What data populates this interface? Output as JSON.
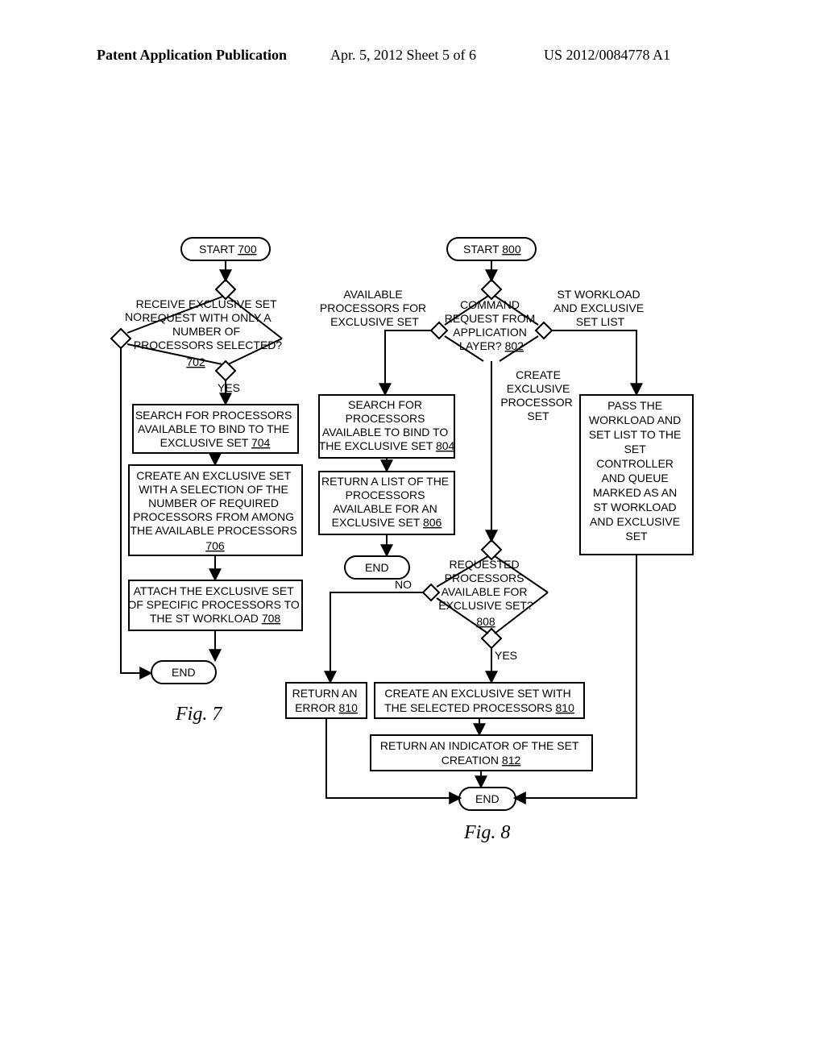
{
  "header": {
    "left": "Patent Application Publication",
    "mid": "Apr. 5, 2012  Sheet 5 of 6",
    "right": "US 2012/0084778 A1"
  },
  "fig7": {
    "start": "START",
    "start_ref": "700",
    "d702_l1": "RECEIVE EXCLUSIVE SET",
    "d702_l2": "REQUEST WITH ONLY A",
    "d702_l3": "NUMBER OF",
    "d702_l4": "PROCESSORS SELECTED?",
    "d702_ref": "702",
    "no": "NO",
    "yes": "YES",
    "b704_l1": "SEARCH FOR PROCESSORS",
    "b704_l2": "AVAILABLE TO BIND TO THE",
    "b704_l3": "EXCLUSIVE SET",
    "b704_ref": "704",
    "b706_l1": "CREATE AN EXCLUSIVE SET",
    "b706_l2": "WITH A SELECTION OF THE",
    "b706_l3": "NUMBER OF REQUIRED",
    "b706_l4": "PROCESSORS FROM AMONG",
    "b706_l5": "THE AVAILABLE PROCESSORS",
    "b706_ref": "706",
    "b708_l1": "ATTACH THE EXCLUSIVE SET",
    "b708_l2": "OF SPECIFIC PROCESSORS TO",
    "b708_l3": "THE ST WORKLOAD",
    "b708_ref": "708",
    "end": "END",
    "label": "Fig. 7"
  },
  "fig8": {
    "start": "START",
    "start_ref": "800",
    "d802_l1": "COMMAND",
    "d802_l2": "REQUEST FROM",
    "d802_l3": "APPLICATION",
    "d802_l4": "LAYER?",
    "d802_ref": "802",
    "branch_left_l1": "AVAILABLE",
    "branch_left_l2": "PROCESSORS FOR",
    "branch_left_l3": "EXCLUSIVE SET",
    "branch_mid_l1": "CREATE",
    "branch_mid_l2": "EXCLUSIVE",
    "branch_mid_l3": "PROCESSOR",
    "branch_mid_l4": "SET",
    "branch_right_l1": "ST WORKLOAD",
    "branch_right_l2": "AND EXCLUSIVE",
    "branch_right_l3": "SET LIST",
    "b804_l1": "SEARCH FOR",
    "b804_l2": "PROCESSORS",
    "b804_l3": "AVAILABLE TO BIND TO",
    "b804_l4": "THE EXCLUSIVE SET",
    "b804_ref": "804",
    "b806_l1": "RETURN A LIST OF THE",
    "b806_l2": "PROCESSORS",
    "b806_l3": "AVAILABLE FOR AN",
    "b806_l4": "EXCLUSIVE SET",
    "b806_ref": "806",
    "end_mid": "END",
    "d808_l1": "REQUESTED",
    "d808_l2": "PROCESSORS",
    "d808_l3": "AVAILABLE FOR",
    "d808_l4": "EXCLUSIVE SET?",
    "d808_ref": "808",
    "no": "NO",
    "yes": "YES",
    "bPass_l1": "PASS THE",
    "bPass_l2": "WORKLOAD AND",
    "bPass_l3": "SET LIST TO THE",
    "bPass_l4": "SET",
    "bPass_l5": "CONTROLLER",
    "bPass_l6": "AND QUEUE",
    "bPass_l7": "MARKED AS AN",
    "bPass_l8": "ST WORKLOAD",
    "bPass_l9": "AND EXCLUSIVE",
    "bPass_l10": "SET",
    "b810err_l1": "RETURN AN",
    "b810err_l2": "ERROR",
    "b810err_ref": "810",
    "b810_l1": "CREATE AN EXCLUSIVE SET WITH",
    "b810_l2": "THE SELECTED PROCESSORS",
    "b810_ref": "810",
    "b812_l1": "RETURN AN INDICATOR OF THE SET",
    "b812_l2": "CREATION",
    "b812_ref": "812",
    "end": "END",
    "label": "Fig. 8"
  }
}
